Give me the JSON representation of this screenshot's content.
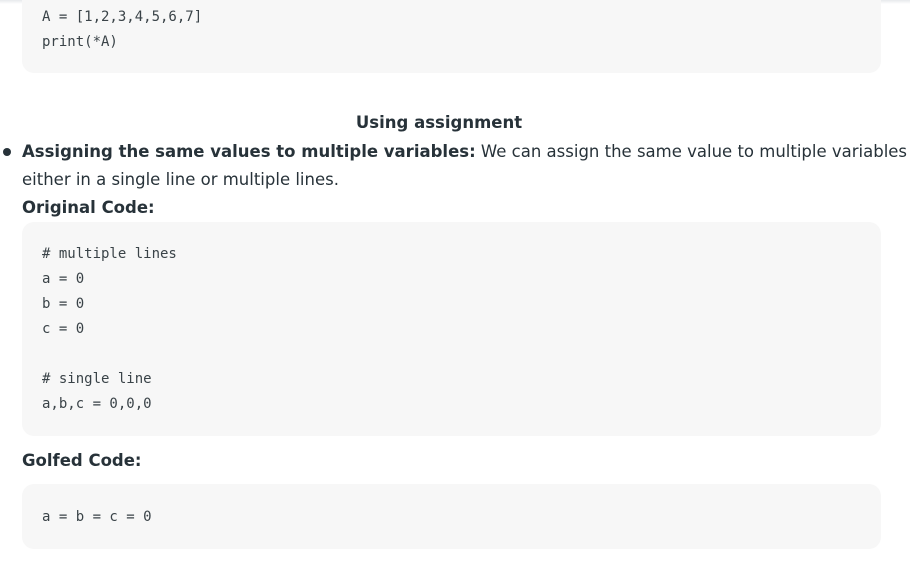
{
  "code_top": {
    "lines": [
      "A = [1,2,3,4,5,6,7]",
      "print(*A)"
    ]
  },
  "section": {
    "heading": "Using assignment"
  },
  "bullet": {
    "bold_text": "Assigning the same values to multiple variables:",
    "text_line1": " We can assign the same value to multiple variables",
    "text_line2": "either in a single line or multiple lines."
  },
  "original_code": {
    "label": "Original Code:",
    "lines": [
      "# multiple lines",
      "a = 0",
      "b = 0",
      "c = 0",
      "",
      "# single line",
      "a,b,c = 0,0,0"
    ]
  },
  "golfed_code": {
    "label": "Golfed Code:",
    "lines": [
      "a = b = c = 0"
    ]
  }
}
